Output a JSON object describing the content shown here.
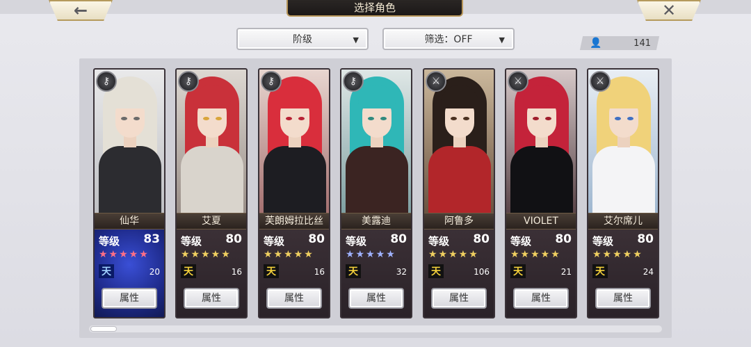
{
  "header": {
    "title": "选择角色",
    "back_icon": "←",
    "close_icon": "✕"
  },
  "filters": {
    "rank_dropdown": "阶级",
    "filter_dropdown": "筛选：OFF",
    "dropdown_arrow": "▼"
  },
  "count": {
    "icon": "👤",
    "value": "141"
  },
  "attr_label": "属性",
  "level_label": "等级",
  "characters": [
    {
      "name": "仙华",
      "level": "83",
      "stars": "★★★★★",
      "star_color": "red",
      "rank_glyph": "天",
      "sub_value": "20",
      "badge_icon": "key-icon",
      "theme": "blue"
    },
    {
      "name": "艾夏",
      "level": "80",
      "stars": "★★★★★",
      "star_color": "gold",
      "rank_glyph": "天",
      "sub_value": "16",
      "badge_icon": "key-icon",
      "theme": "dark"
    },
    {
      "name": "芙朗姆拉比丝",
      "level": "80",
      "stars": "★★★★★",
      "star_color": "gold",
      "rank_glyph": "天",
      "sub_value": "16",
      "badge_icon": "key-icon",
      "theme": "dark"
    },
    {
      "name": "美露迪",
      "level": "80",
      "stars": "★★★★★",
      "star_color": "blue",
      "rank_glyph": "天",
      "sub_value": "32",
      "badge_icon": "key-icon",
      "theme": "dark"
    },
    {
      "name": "阿鲁多",
      "level": "80",
      "stars": "★★★★★",
      "star_color": "gold",
      "rank_glyph": "天",
      "sub_value": "106",
      "badge_icon": "sword-icon",
      "theme": "dark"
    },
    {
      "name": "VIOLET",
      "level": "80",
      "stars": "★★★★★",
      "star_color": "gold",
      "rank_glyph": "天",
      "sub_value": "21",
      "badge_icon": "sword-icon",
      "theme": "dark"
    },
    {
      "name": "艾尔席儿",
      "level": "80",
      "stars": "★★★★★",
      "star_color": "gold",
      "rank_glyph": "天",
      "sub_value": "24",
      "badge_icon": "sword-icon",
      "theme": "dark"
    }
  ],
  "badge_glyphs": {
    "key-icon": "⚷",
    "sword-icon": "⚔"
  },
  "colors": {
    "gold_border": "#b8975a",
    "panel_bg": "#cfcfd6"
  }
}
